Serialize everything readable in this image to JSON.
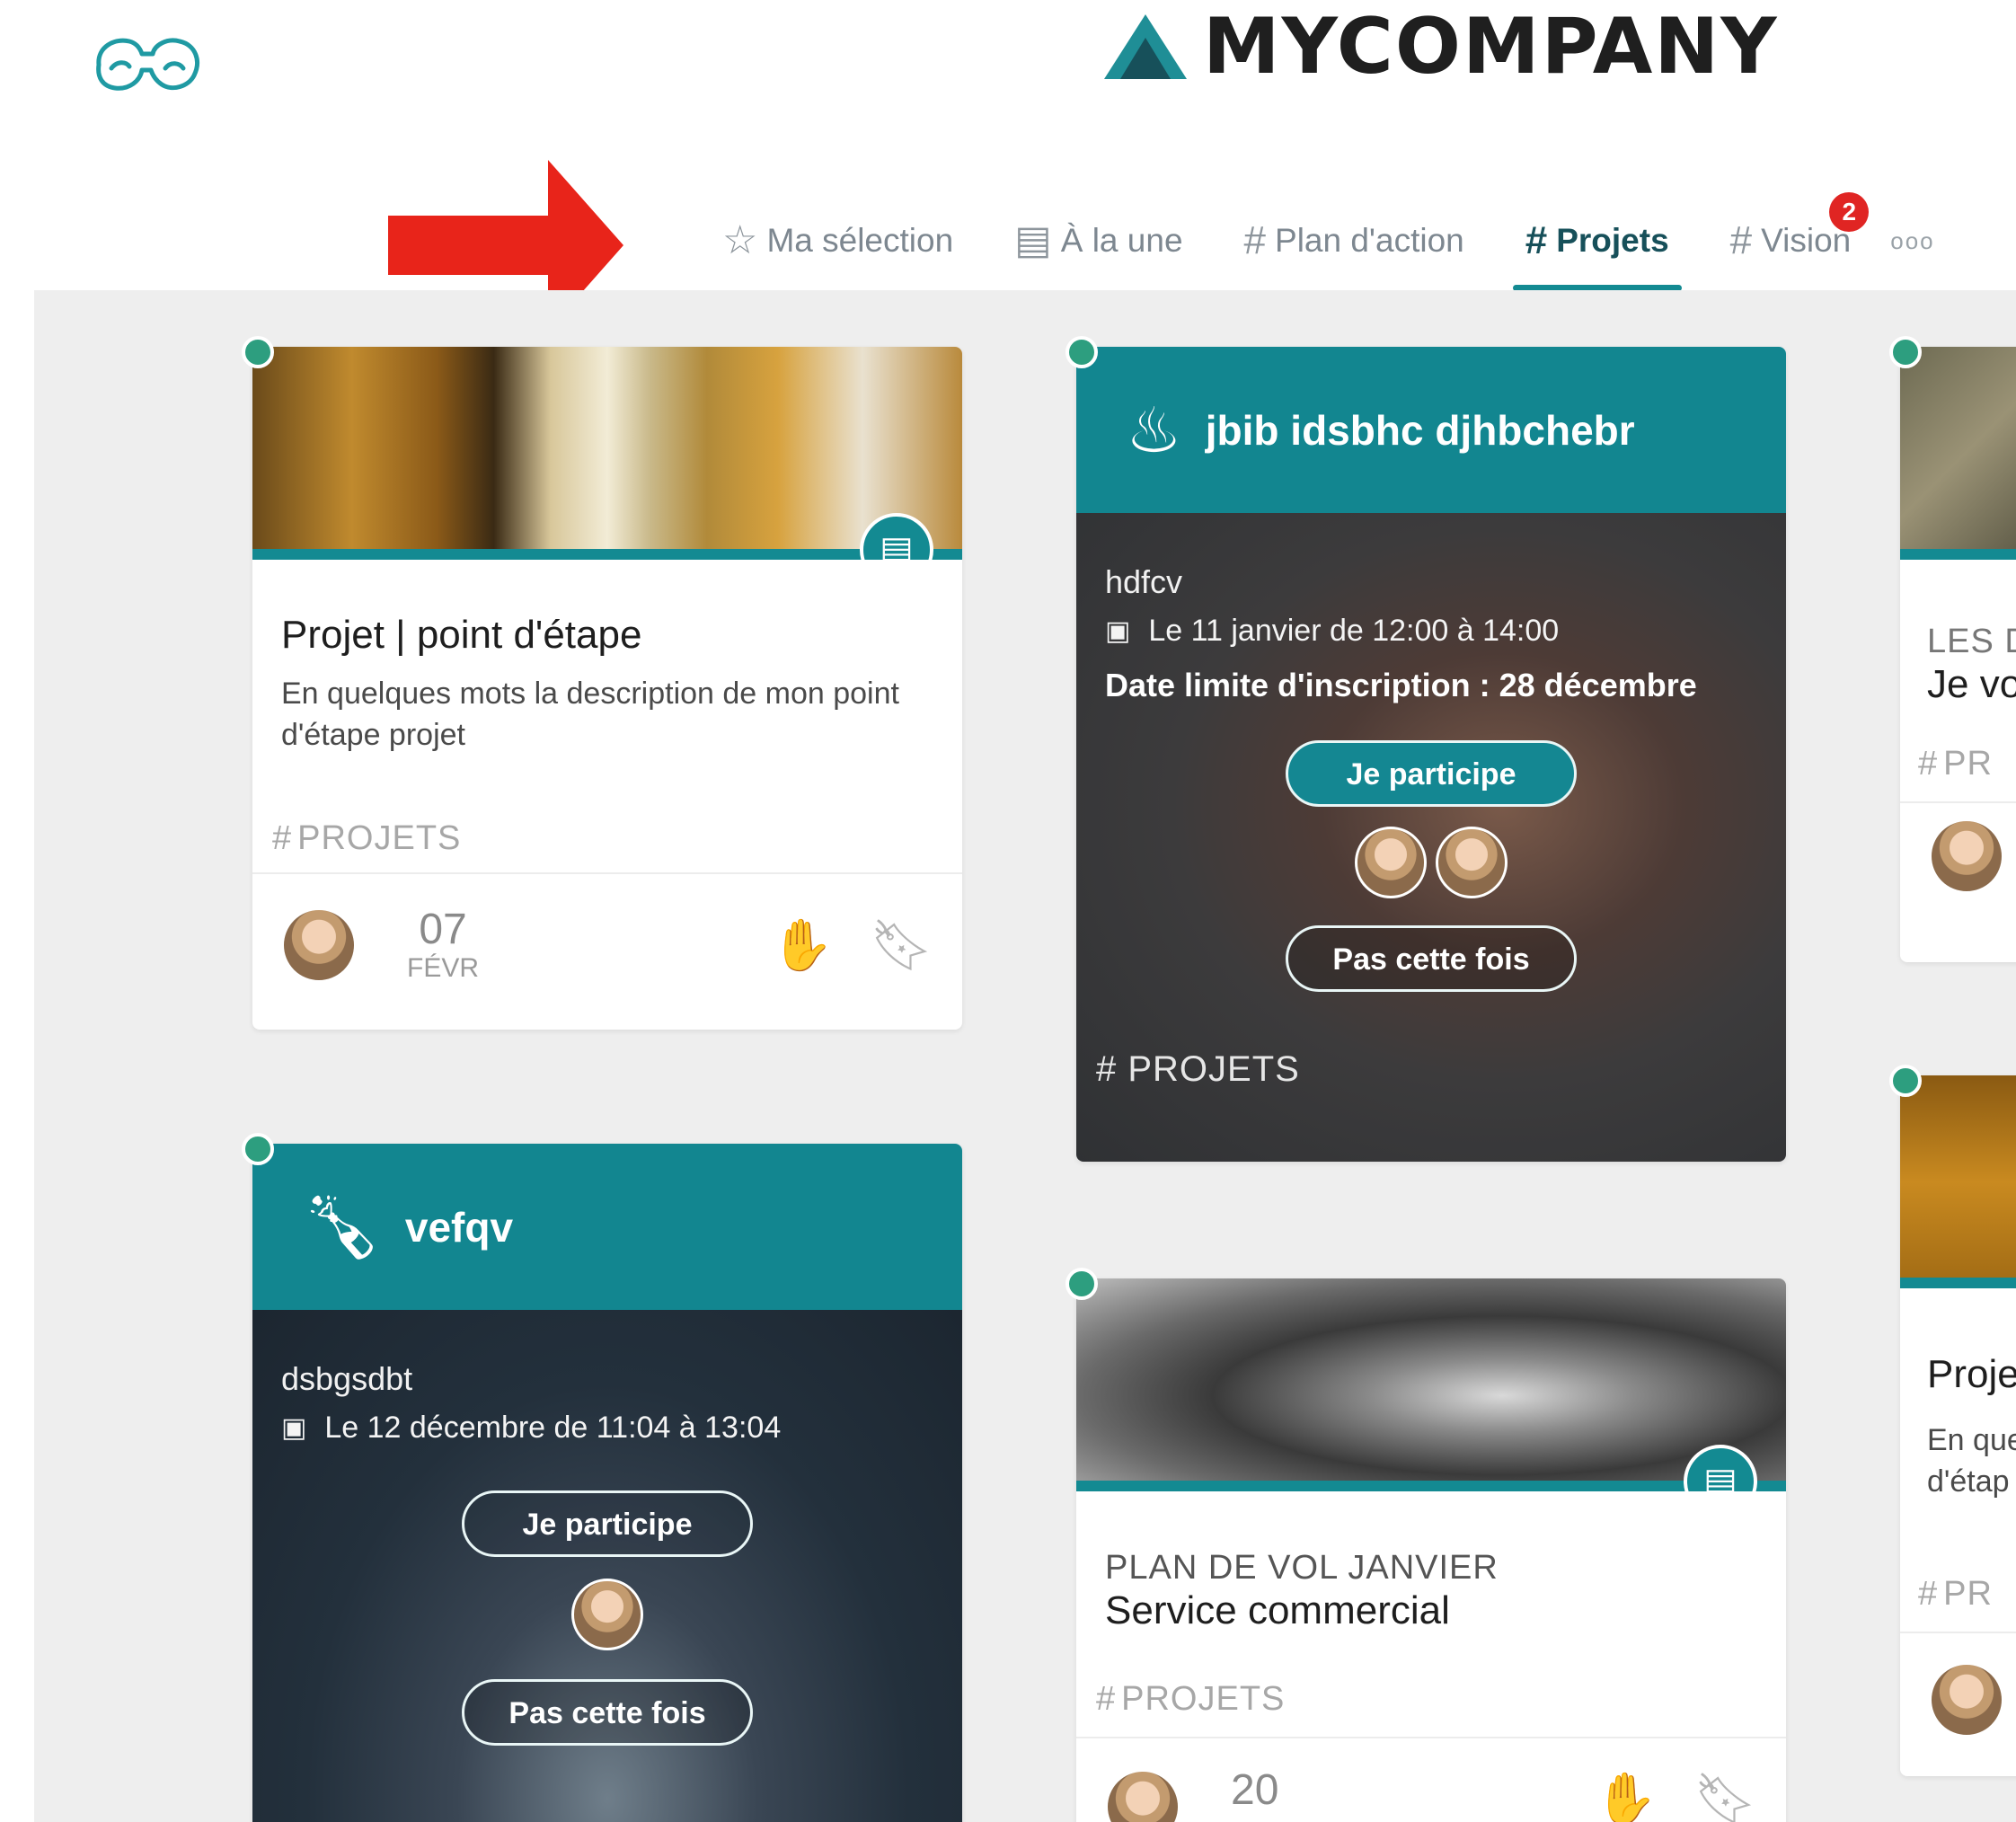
{
  "brand": {
    "name": "MYCOMPANY"
  },
  "nav": {
    "tabs": [
      {
        "icon": "star-icon",
        "glyph": "☆",
        "label": "Ma sélection"
      },
      {
        "icon": "newspaper-icon",
        "glyph": "▤",
        "label": "À la une"
      },
      {
        "icon": "hashtag-icon",
        "glyph": "#",
        "label": "Plan d'action"
      },
      {
        "icon": "hashtag-icon",
        "glyph": "#",
        "label": "Projets"
      },
      {
        "icon": "hashtag-icon",
        "glyph": "#",
        "label": "Vision"
      }
    ],
    "active_tab": "Projets",
    "vision_badge": "2",
    "more": "ooo"
  },
  "cards": {
    "projet": {
      "title": "Projet | point d'étape",
      "description": "En quelques mots la description de mon point d'étape projet",
      "tag": "PROJETS",
      "date_day": "07",
      "date_month": "FÉVR"
    },
    "event1": {
      "title": "jbib idsbhc djhbchebr",
      "name": "hdfcv",
      "when": "Le 11 janvier de 12:00 à 14:00",
      "deadline": "Date limite d'inscription : 28 décembre",
      "participate": "Je participe",
      "decline": "Pas cette fois",
      "tag": "PROJETS"
    },
    "event2": {
      "title": "vefqv",
      "name": "dsbgsdbt",
      "when": "Le 12 décembre de 11:04 à 13:04",
      "participate": "Je participe",
      "decline": "Pas cette fois"
    },
    "service": {
      "eyebrow": "PLAN DE VOL JANVIER",
      "title": "Service commercial",
      "tag": "PROJETS",
      "date_day": "20"
    },
    "right1": {
      "eyebrow": "LES D",
      "title": "Je vo",
      "tag": "PR"
    },
    "right2": {
      "title": "Proje",
      "desc_line1": "En que",
      "desc_line2": "d'étap",
      "tag": "PR"
    }
  },
  "colors": {
    "accent": "#138a92",
    "event_header": "#128690",
    "status_dot": "#2d9e7f",
    "badge": "#e02523",
    "arrow": "#e8241a",
    "feed_bg": "#eeeeee"
  }
}
